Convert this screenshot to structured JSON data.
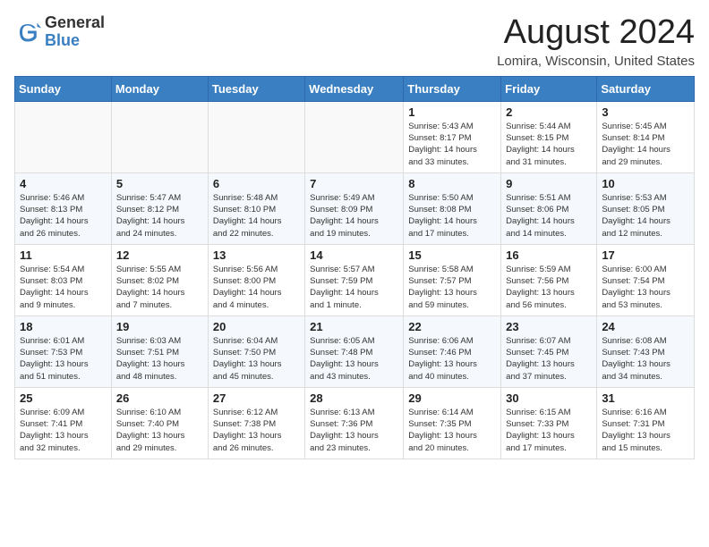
{
  "logo": {
    "line1": "General",
    "line2": "Blue"
  },
  "title": "August 2024",
  "location": "Lomira, Wisconsin, United States",
  "days_of_week": [
    "Sunday",
    "Monday",
    "Tuesday",
    "Wednesday",
    "Thursday",
    "Friday",
    "Saturday"
  ],
  "weeks": [
    [
      {
        "day": "",
        "info": ""
      },
      {
        "day": "",
        "info": ""
      },
      {
        "day": "",
        "info": ""
      },
      {
        "day": "",
        "info": ""
      },
      {
        "day": "1",
        "info": "Sunrise: 5:43 AM\nSunset: 8:17 PM\nDaylight: 14 hours\nand 33 minutes."
      },
      {
        "day": "2",
        "info": "Sunrise: 5:44 AM\nSunset: 8:15 PM\nDaylight: 14 hours\nand 31 minutes."
      },
      {
        "day": "3",
        "info": "Sunrise: 5:45 AM\nSunset: 8:14 PM\nDaylight: 14 hours\nand 29 minutes."
      }
    ],
    [
      {
        "day": "4",
        "info": "Sunrise: 5:46 AM\nSunset: 8:13 PM\nDaylight: 14 hours\nand 26 minutes."
      },
      {
        "day": "5",
        "info": "Sunrise: 5:47 AM\nSunset: 8:12 PM\nDaylight: 14 hours\nand 24 minutes."
      },
      {
        "day": "6",
        "info": "Sunrise: 5:48 AM\nSunset: 8:10 PM\nDaylight: 14 hours\nand 22 minutes."
      },
      {
        "day": "7",
        "info": "Sunrise: 5:49 AM\nSunset: 8:09 PM\nDaylight: 14 hours\nand 19 minutes."
      },
      {
        "day": "8",
        "info": "Sunrise: 5:50 AM\nSunset: 8:08 PM\nDaylight: 14 hours\nand 17 minutes."
      },
      {
        "day": "9",
        "info": "Sunrise: 5:51 AM\nSunset: 8:06 PM\nDaylight: 14 hours\nand 14 minutes."
      },
      {
        "day": "10",
        "info": "Sunrise: 5:53 AM\nSunset: 8:05 PM\nDaylight: 14 hours\nand 12 minutes."
      }
    ],
    [
      {
        "day": "11",
        "info": "Sunrise: 5:54 AM\nSunset: 8:03 PM\nDaylight: 14 hours\nand 9 minutes."
      },
      {
        "day": "12",
        "info": "Sunrise: 5:55 AM\nSunset: 8:02 PM\nDaylight: 14 hours\nand 7 minutes."
      },
      {
        "day": "13",
        "info": "Sunrise: 5:56 AM\nSunset: 8:00 PM\nDaylight: 14 hours\nand 4 minutes."
      },
      {
        "day": "14",
        "info": "Sunrise: 5:57 AM\nSunset: 7:59 PM\nDaylight: 14 hours\nand 1 minute."
      },
      {
        "day": "15",
        "info": "Sunrise: 5:58 AM\nSunset: 7:57 PM\nDaylight: 13 hours\nand 59 minutes."
      },
      {
        "day": "16",
        "info": "Sunrise: 5:59 AM\nSunset: 7:56 PM\nDaylight: 13 hours\nand 56 minutes."
      },
      {
        "day": "17",
        "info": "Sunrise: 6:00 AM\nSunset: 7:54 PM\nDaylight: 13 hours\nand 53 minutes."
      }
    ],
    [
      {
        "day": "18",
        "info": "Sunrise: 6:01 AM\nSunset: 7:53 PM\nDaylight: 13 hours\nand 51 minutes."
      },
      {
        "day": "19",
        "info": "Sunrise: 6:03 AM\nSunset: 7:51 PM\nDaylight: 13 hours\nand 48 minutes."
      },
      {
        "day": "20",
        "info": "Sunrise: 6:04 AM\nSunset: 7:50 PM\nDaylight: 13 hours\nand 45 minutes."
      },
      {
        "day": "21",
        "info": "Sunrise: 6:05 AM\nSunset: 7:48 PM\nDaylight: 13 hours\nand 43 minutes."
      },
      {
        "day": "22",
        "info": "Sunrise: 6:06 AM\nSunset: 7:46 PM\nDaylight: 13 hours\nand 40 minutes."
      },
      {
        "day": "23",
        "info": "Sunrise: 6:07 AM\nSunset: 7:45 PM\nDaylight: 13 hours\nand 37 minutes."
      },
      {
        "day": "24",
        "info": "Sunrise: 6:08 AM\nSunset: 7:43 PM\nDaylight: 13 hours\nand 34 minutes."
      }
    ],
    [
      {
        "day": "25",
        "info": "Sunrise: 6:09 AM\nSunset: 7:41 PM\nDaylight: 13 hours\nand 32 minutes."
      },
      {
        "day": "26",
        "info": "Sunrise: 6:10 AM\nSunset: 7:40 PM\nDaylight: 13 hours\nand 29 minutes."
      },
      {
        "day": "27",
        "info": "Sunrise: 6:12 AM\nSunset: 7:38 PM\nDaylight: 13 hours\nand 26 minutes."
      },
      {
        "day": "28",
        "info": "Sunrise: 6:13 AM\nSunset: 7:36 PM\nDaylight: 13 hours\nand 23 minutes."
      },
      {
        "day": "29",
        "info": "Sunrise: 6:14 AM\nSunset: 7:35 PM\nDaylight: 13 hours\nand 20 minutes."
      },
      {
        "day": "30",
        "info": "Sunrise: 6:15 AM\nSunset: 7:33 PM\nDaylight: 13 hours\nand 17 minutes."
      },
      {
        "day": "31",
        "info": "Sunrise: 6:16 AM\nSunset: 7:31 PM\nDaylight: 13 hours\nand 15 minutes."
      }
    ]
  ]
}
